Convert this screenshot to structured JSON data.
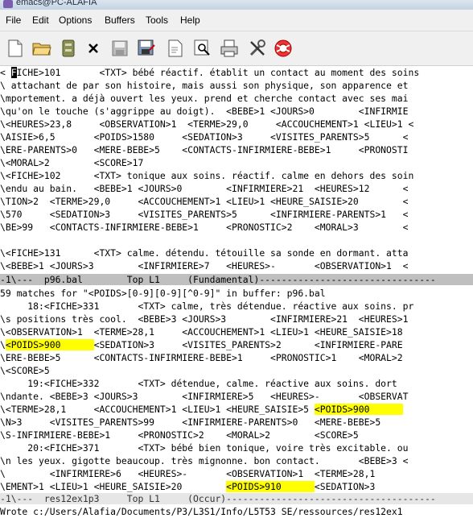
{
  "window": {
    "title": "emacs@PC-ALAFIA"
  },
  "menubar": {
    "items": [
      "File",
      "Edit",
      "Options",
      "Buffers",
      "Tools",
      "Help"
    ]
  },
  "toolbar": {
    "icons": [
      "new-file-icon",
      "open-folder-icon",
      "dired-icon",
      "close-icon",
      "save-icon",
      "save-as-icon",
      "undo-icon",
      "search-icon",
      "print-icon",
      "preferences-icon",
      "help-icon"
    ]
  },
  "top_buffer": {
    "lines": [
      [
        [
          "< ",
          ""
        ],
        [
          "F",
          "cursor"
        ],
        [
          "ICHE>101       <TXT> bébé réactif. établit un contact au moment des soins",
          ""
        ]
      ],
      [
        [
          "\\ attachant de par son histoire, mais aussi son physique, son apparence et",
          ""
        ]
      ],
      [
        [
          "\\mportement. a déjà ouvert les yeux. prend et cherche contact avec ses mai",
          ""
        ]
      ],
      [
        [
          "\\qu'on le touche (s'aggrippe au doigt).  <BEBE>1 <JOURS>0        <INFIRMIE",
          ""
        ]
      ],
      [
        [
          "\\<HEURES>23,8     <OBSERVATION>1  <TERME>29,0     <ACCOUCHEMENT>1 <LIEU>1 <",
          ""
        ]
      ],
      [
        [
          "\\AISIE>6,5       <POIDS>1580     <SEDATION>3     <VISITES_PARENTS>5      <",
          ""
        ]
      ],
      [
        [
          "\\ERE-PARENTS>0   <MERE-BEBE>5    <CONTACTS-INFIRMIERE-BEBE>1     <PRONOSTI",
          ""
        ]
      ],
      [
        [
          "\\<MORAL>2        <SCORE>17",
          ""
        ]
      ],
      [
        [
          "\\<FICHE>102      <TXT> tonique aux soins. réactif. calme en dehors des soin",
          ""
        ]
      ],
      [
        [
          "\\endu au bain.   <BEBE>1 <JOURS>0        <INFIRMIERE>21  <HEURES>12      <",
          ""
        ]
      ],
      [
        [
          "\\TION>2  <TERME>29,0     <ACCOUCHEMENT>1 <LIEU>1 <HEURE_SAISIE>20        <",
          ""
        ]
      ],
      [
        [
          "\\570     <SEDATION>3     <VISITES_PARENTS>5      <INFIRMIERE-PARENTS>1   <",
          ""
        ]
      ],
      [
        [
          "\\BE>99   <CONTACTS-INFIRMIERE-BEBE>1     <PRONOSTIC>2    <MORAL>3        <",
          ""
        ]
      ],
      [
        [
          "",
          ""
        ]
      ],
      [
        [
          "\\<FICHE>131      <TXT> calme. détendu. tétouille sa sonde en dormant. atta",
          ""
        ]
      ],
      [
        [
          "\\<BEBE>1 <JOURS>3        <INFIRMIERE>7   <HEURES>-       <OBSERVATION>1  <",
          ""
        ]
      ]
    ]
  },
  "top_modeline": "-1\\---  p96.bal        Top L1     (Fundamental)--------------------------------",
  "bottom_buffer": {
    "lines": [
      [
        [
          "59 matches for \"<POIDS>[0-9][0-9][^0-9]\" in buffer: p96.bal",
          ""
        ]
      ],
      [
        [
          "     18:<FICHE>331       <TXT> calme, très détendue. réactive aux soins. pr",
          ""
        ]
      ],
      [
        [
          "\\s positions très cool.  <BEBE>3 <JOURS>3        <INFIRMIERE>21  <HEURES>1",
          ""
        ]
      ],
      [
        [
          "\\<OBSERVATION>1  <TERME>28,1     <ACCOUCHEMENT>1 <LIEU>1 <HEURE_SAISIE>18",
          ""
        ]
      ],
      [
        [
          "\\",
          ""
        ],
        [
          "<POIDS>900      ",
          "hl"
        ],
        [
          "<SEDATION>3     <VISITES_PARENTS>2      <INFIRMIERE-PARE",
          ""
        ]
      ],
      [
        [
          "\\ERE-BEBE>5      <CONTACTS-INFIRMIERE-BEBE>1     <PRONOSTIC>1    <MORAL>2",
          ""
        ]
      ],
      [
        [
          "\\<SCORE>5",
          ""
        ]
      ],
      [
        [
          "     19:<FICHE>332       <TXT> détendue, calme. réactive aux soins. dort",
          ""
        ]
      ],
      [
        [
          "\\ndante. <BEBE>3 <JOURS>3        <INFIRMIERE>5   <HEURES>-       <OBSERVAT",
          ""
        ]
      ],
      [
        [
          "\\<TERME>28,1     <ACCOUCHEMENT>1 <LIEU>1 <HEURE_SAISIE>5 ",
          ""
        ],
        [
          "<POIDS>900      ",
          "hl"
        ]
      ],
      [
        [
          "\\N>3     <VISITES_PARENTS>99     <INFIRMIERE-PARENTS>0   <MERE-BEBE>5",
          ""
        ]
      ],
      [
        [
          "\\S-INFIRMIERE-BEBE>1     <PRONOSTIC>2    <MORAL>2        <SCORE>5",
          ""
        ]
      ],
      [
        [
          "     20:<FICHE>371       <TXT> bébé bien tonique, voire très excitable. ou",
          ""
        ]
      ],
      [
        [
          "\\n les yeux. gigotte beaucoup. très mignonne. bon contact.       <BEBE>3 <",
          ""
        ]
      ],
      [
        [
          "\\        <INFIRMIERE>6   <HEURES>-       <OBSERVATION>1  <TERME>28,1",
          ""
        ]
      ],
      [
        [
          "\\EMENT>1 <LIEU>1 <HEURE_SAISIE>20        ",
          ""
        ],
        [
          "<POIDS>910      ",
          "hl"
        ],
        [
          "<SEDATION>3",
          ""
        ]
      ]
    ]
  },
  "bottom_modeline": "-1\\---  res12ex1p3     Top L1     (Occur)--------------------------------------",
  "minibuffer": "Wrote c:/Users/Alafia/Documents/P3/L3S1/Info/L5T53 SE/ressources/res12ex1"
}
